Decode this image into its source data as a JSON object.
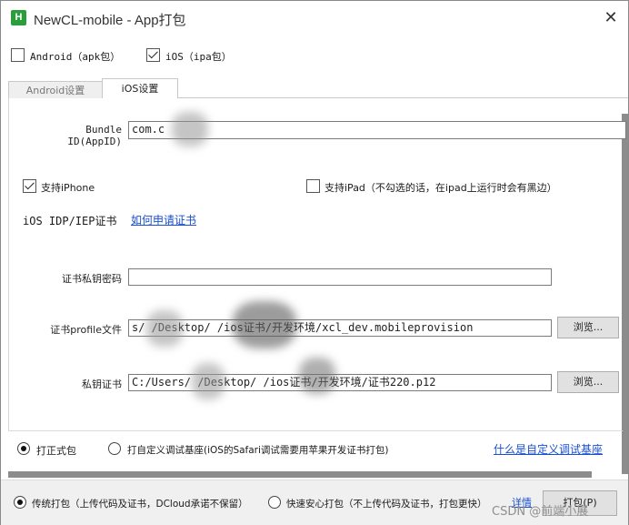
{
  "window": {
    "title": "NewCL-mobile - App打包",
    "app_icon_letter": "H",
    "close_glyph": "✕"
  },
  "platforms": {
    "android": {
      "label": "Android（apk包）",
      "checked": false
    },
    "ios": {
      "label": "iOS（ipa包）",
      "checked": true
    }
  },
  "tabs": [
    {
      "label": "Android设置",
      "active": false
    },
    {
      "label": "iOS设置",
      "active": true
    }
  ],
  "ios_settings": {
    "bundle_id": {
      "label": "Bundle ID(AppID)",
      "value": "com.c"
    },
    "support_iphone": {
      "label": "支持iPhone",
      "checked": true
    },
    "support_ipad": {
      "label": "支持iPad（不勾选的话，在ipad上运行时会有黑边）",
      "checked": false
    },
    "cert_heading": "iOS IDP/IEP证书",
    "cert_help_link": "如何申请证书",
    "cert_password": {
      "label": "证书私钥密码",
      "value": ""
    },
    "profile": {
      "label": "证书profile文件",
      "value": "s/     /Desktop/    /ios证书/开发环境/xcl_dev.mobileprovision",
      "browse": "浏览..."
    },
    "private_key": {
      "label": "私钥证书",
      "value": "C:/Users/     /Desktop/     /ios证书/开发环境/证书220.p12",
      "browse": "浏览..."
    }
  },
  "build_type": {
    "formal": {
      "label": "打正式包",
      "selected": true
    },
    "custom_debug": {
      "label": "打自定义调试基座(iOS的Safari调试需要用苹果开发证书打包)",
      "selected": false
    },
    "help_link": "什么是自定义调试基座"
  },
  "packaging": {
    "traditional": {
      "label": "传统打包（上传代码及证书，DCloud承诺不保留）",
      "selected": true
    },
    "safe": {
      "label": "快速安心打包（不上传代码及证书，打包更快）",
      "selected": false
    },
    "details_link": "详情",
    "pack_button": "打包(P)"
  },
  "watermark": "CSDN @前端小展",
  "colors": {
    "accent_link": "#1a4fd0",
    "app_icon": "#2a9d3c",
    "bottom_bar": "#f0f0f0"
  }
}
